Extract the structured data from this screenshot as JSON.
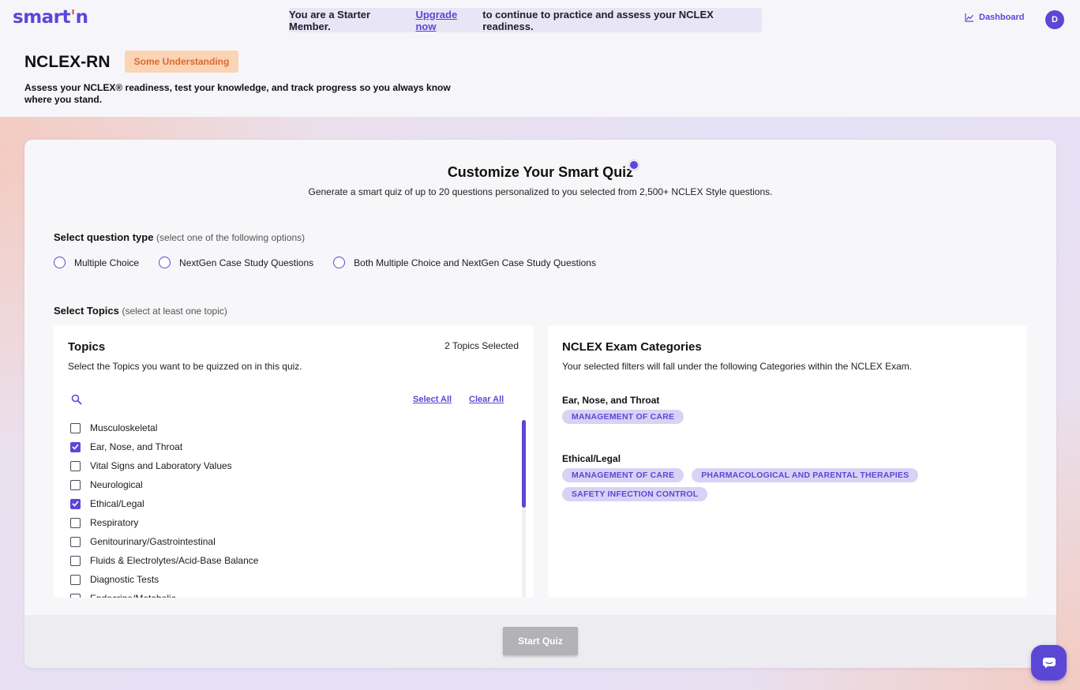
{
  "app": {
    "logo_text": "smart",
    "logo_accent": "'",
    "logo_suffix": "n"
  },
  "banner": {
    "prefix": "You are a Starter Member.",
    "link": "Upgrade now",
    "suffix": "to continue to practice and assess your NCLEX readiness."
  },
  "nav": {
    "dashboard_label": "Dashboard",
    "avatar_initial": "D"
  },
  "header": {
    "title": "NCLEX-RN",
    "badge": "Some Understanding",
    "description": "Assess your NCLEX® readiness, test your knowledge, and track progress so you always know where you stand."
  },
  "quiz": {
    "title": "Customize Your Smart Quiz",
    "subtitle": "Generate a smart quiz of up to 20 questions personalized to you selected from 2,500+ NCLEX Style questions.",
    "question_type_label": "Select question type",
    "question_type_hint": "(select one of the following options)",
    "question_types": [
      "Multiple Choice",
      "NextGen Case Study Questions",
      "Both Multiple Choice and NextGen Case Study Questions"
    ],
    "topics_label": "Select Topics",
    "topics_hint": "(select at least one topic)",
    "start_button": "Start Quiz"
  },
  "topics_panel": {
    "title": "Topics",
    "count": "2 Topics Selected",
    "description": "Select the Topics you want to be quizzed on in this quiz.",
    "select_all": "Select All",
    "clear_all": "Clear All",
    "items": [
      {
        "label": "Musculoskeletal",
        "checked": false
      },
      {
        "label": "Ear, Nose, and Throat",
        "checked": true
      },
      {
        "label": "Vital Signs and Laboratory Values",
        "checked": false
      },
      {
        "label": "Neurological",
        "checked": false
      },
      {
        "label": "Ethical/Legal",
        "checked": true
      },
      {
        "label": "Respiratory",
        "checked": false
      },
      {
        "label": "Genitourinary/Gastrointestinal",
        "checked": false
      },
      {
        "label": "Fluids & Electrolytes/Acid-Base Balance",
        "checked": false
      },
      {
        "label": "Diagnostic Tests",
        "checked": false
      },
      {
        "label": "Endocrine/Metabolic",
        "checked": false
      }
    ]
  },
  "categories_panel": {
    "title": "NCLEX Exam Categories",
    "description": "Your selected filters will fall under the following Categories within the NCLEX Exam.",
    "groups": [
      {
        "name": "Ear, Nose, and Throat",
        "tags": [
          "MANAGEMENT OF CARE"
        ]
      },
      {
        "name": "Ethical/Legal",
        "tags": [
          "MANAGEMENT OF CARE",
          "PHARMACOLOGICAL AND PARENTAL THERAPIES",
          "SAFETY INFECTION CONTROL"
        ]
      }
    ]
  },
  "colors": {
    "brand": "#5b47d6",
    "logo_accent": "#ef6b5a",
    "badge_bg": "#fbd3b5",
    "badge_text": "#d96a2d",
    "pill_bg": "#d8d2f5",
    "disabled_button": "#b3b3b6"
  },
  "icons": [
    "chart-icon",
    "search-icon",
    "chat-icon"
  ]
}
